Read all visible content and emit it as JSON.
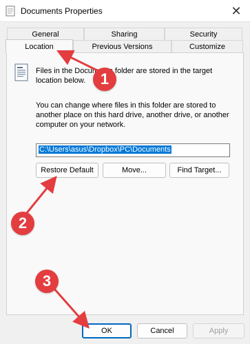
{
  "window": {
    "title": "Documents Properties",
    "close_glyph": "✕"
  },
  "tabs": [
    {
      "label": "General"
    },
    {
      "label": "Sharing"
    },
    {
      "label": "Security"
    },
    {
      "label": "Location",
      "active": true
    },
    {
      "label": "Previous Versions"
    },
    {
      "label": "Customize"
    }
  ],
  "location": {
    "info_text": "Files in the Documents folder are stored in the target location below.",
    "description": "You can change where files in this folder are stored to another place on this hard drive, another drive, or another computer on your network.",
    "path_value": "C:\\Users\\asus\\Dropbox\\PC\\Documents",
    "restore_default_label": "Restore Default",
    "move_label": "Move...",
    "find_target_label": "Find Target..."
  },
  "footer": {
    "ok_label": "OK",
    "cancel_label": "Cancel",
    "apply_label": "Apply"
  },
  "annotations": {
    "badge_1": "1",
    "badge_2": "2",
    "badge_3": "3",
    "color": "#e33d3f"
  }
}
